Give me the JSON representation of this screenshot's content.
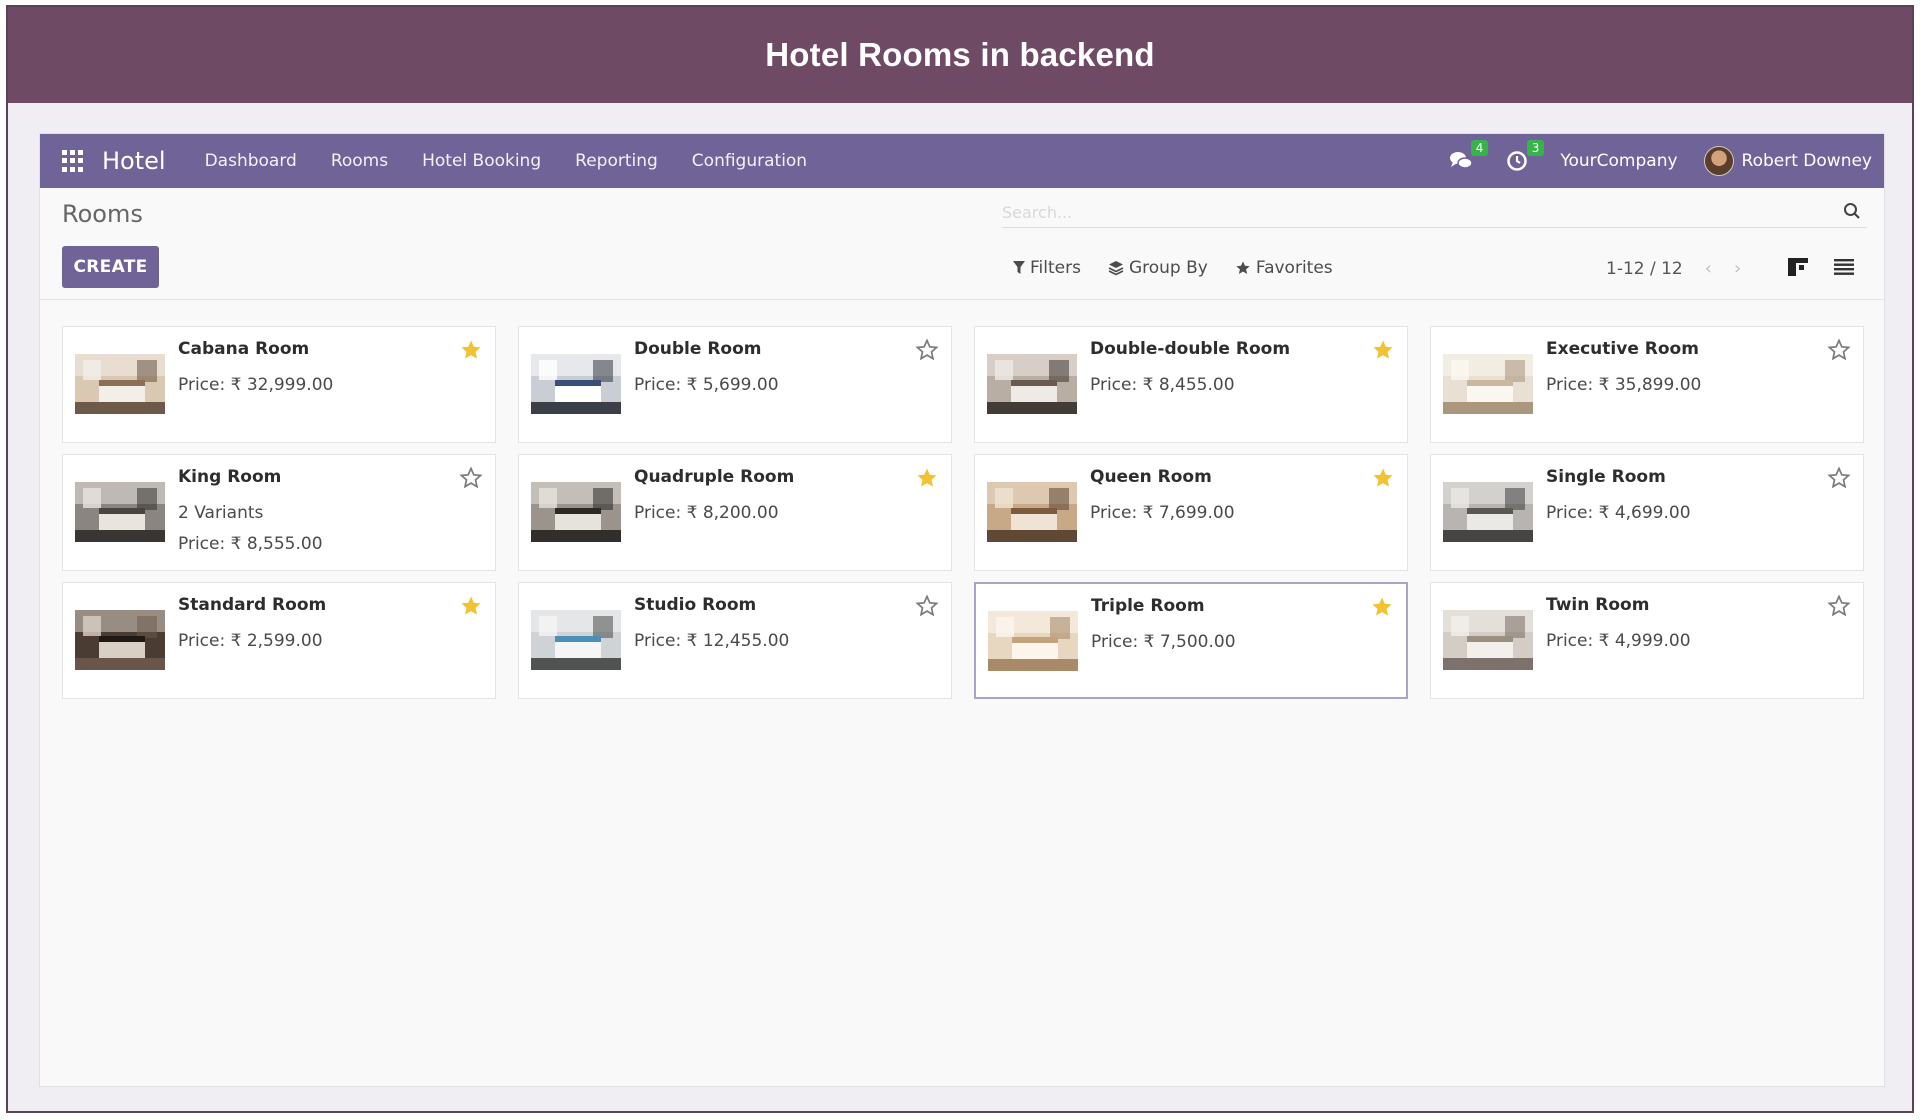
{
  "banner": {
    "title": "Hotel Rooms in backend"
  },
  "navbar": {
    "brand": "Hotel",
    "menu": [
      "Dashboard",
      "Rooms",
      "Hotel Booking",
      "Reporting",
      "Configuration"
    ],
    "messages_count": "4",
    "activities_count": "3",
    "company": "YourCompany",
    "user": "Robert Downey"
  },
  "control_panel": {
    "title": "Rooms",
    "create_label": "CREATE",
    "search_placeholder": "Search...",
    "filters_label": "Filters",
    "group_by_label": "Group By",
    "favorites_label": "Favorites",
    "pager": "1-12 / 12"
  },
  "rooms": [
    {
      "name": "Cabana Room",
      "variants": "",
      "price": "Price: ₹ 32,999.00",
      "favorite": true,
      "img": "cabana"
    },
    {
      "name": "Double Room",
      "variants": "",
      "price": "Price: ₹ 5,699.00",
      "favorite": false,
      "img": "double"
    },
    {
      "name": "Double-double Room",
      "variants": "",
      "price": "Price: ₹ 8,455.00",
      "favorite": true,
      "img": "doubledouble"
    },
    {
      "name": "Executive Room",
      "variants": "",
      "price": "Price: ₹ 35,899.00",
      "favorite": false,
      "img": "executive"
    },
    {
      "name": "King Room",
      "variants": "2 Variants",
      "price": "Price: ₹ 8,555.00",
      "favorite": false,
      "img": "king"
    },
    {
      "name": "Quadruple Room",
      "variants": "",
      "price": "Price: ₹ 8,200.00",
      "favorite": true,
      "img": "quadruple"
    },
    {
      "name": "Queen Room",
      "variants": "",
      "price": "Price: ₹ 7,699.00",
      "favorite": true,
      "img": "queen"
    },
    {
      "name": "Single Room",
      "variants": "",
      "price": "Price: ₹ 4,699.00",
      "favorite": false,
      "img": "single"
    },
    {
      "name": "Standard Room",
      "variants": "",
      "price": "Price: ₹ 2,599.00",
      "favorite": true,
      "img": "standard"
    },
    {
      "name": "Studio Room",
      "variants": "",
      "price": "Price: ₹ 12,455.00",
      "favorite": false,
      "img": "studio"
    },
    {
      "name": "Triple Room",
      "variants": "",
      "price": "Price: ₹ 7,500.00",
      "favorite": true,
      "img": "triple"
    },
    {
      "name": "Twin Room",
      "variants": "",
      "price": "Price: ₹ 4,999.00",
      "favorite": false,
      "img": "twin"
    }
  ],
  "colors": {
    "banner": "#6e4a65",
    "navbar": "#6f6398",
    "primary_button": "#6f6398",
    "star_active": "#f3c230",
    "star_inactive": "#7a7a7a",
    "badge": "#36b349"
  }
}
